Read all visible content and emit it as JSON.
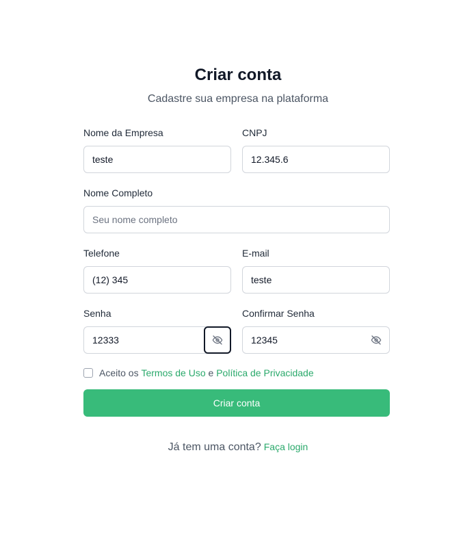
{
  "header": {
    "title": "Criar conta",
    "subtitle": "Cadastre sua empresa na plataforma"
  },
  "form": {
    "company_name": {
      "label": "Nome da Empresa",
      "value": "teste",
      "placeholder": ""
    },
    "cnpj": {
      "label": "CNPJ",
      "value": "12.345.6",
      "placeholder": ""
    },
    "full_name": {
      "label": "Nome Completo",
      "value": "",
      "placeholder": "Seu nome completo"
    },
    "phone": {
      "label": "Telefone",
      "value": "(12) 345",
      "placeholder": ""
    },
    "email": {
      "label": "E-mail",
      "value": "teste",
      "placeholder": ""
    },
    "password": {
      "label": "Senha",
      "value": "12333",
      "placeholder": ""
    },
    "confirm_password": {
      "label": "Confirmar Senha",
      "value": "12345",
      "placeholder": ""
    }
  },
  "terms": {
    "prefix": "Aceito os",
    "terms_link": "Termos de Uso",
    "connector": "e",
    "privacy_link": "Política de Privacidade",
    "checked": false
  },
  "submit_label": "Criar conta",
  "footer": {
    "question": "Já tem uma conta?",
    "login_link": "Faça login"
  },
  "icons": {
    "password_toggle": "eye-off-icon"
  },
  "colors": {
    "accent": "#38bb7a",
    "link": "#2aa96b",
    "text": "#111827",
    "muted": "#4b5563",
    "border": "#d1d5db"
  }
}
